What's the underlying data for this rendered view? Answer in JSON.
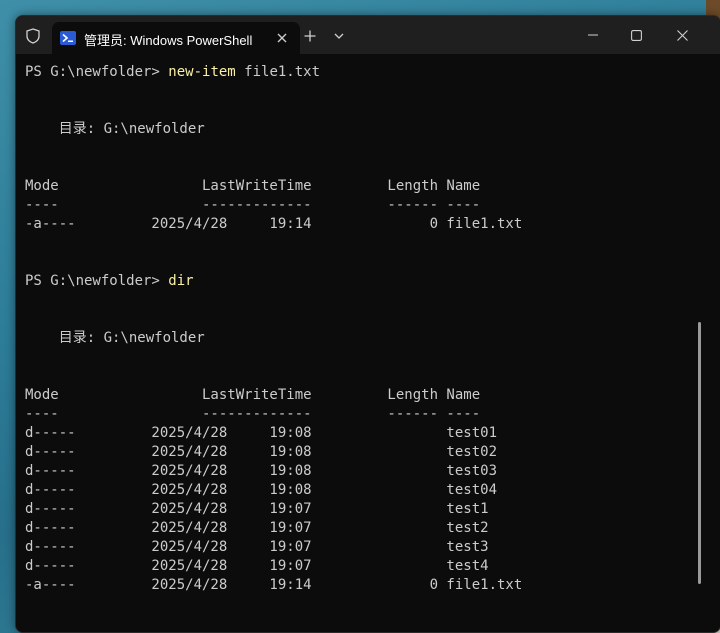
{
  "titlebar": {
    "tab_title": "管理员: Windows PowerShell",
    "new_tab_glyph": "+",
    "dropdown_glyph": "⌄"
  },
  "colors": {
    "terminal_bg": "#0c0c0c",
    "titlebar_bg": "#1f1f1f",
    "text": "#cccccc",
    "command": "#f9f1a5"
  },
  "terminal": {
    "block1": {
      "prompt": "PS G:\\newfolder> ",
      "command": "new-item",
      "args": " file1.txt",
      "directory": "    目录: G:\\newfolder",
      "header": "Mode                 LastWriteTime         Length Name",
      "underline": "----                 -------------         ------ ----",
      "rows": [
        "-a----         2025/4/28     19:14              0 file1.txt"
      ]
    },
    "block2": {
      "prompt": "PS G:\\newfolder> ",
      "command": "dir",
      "directory": "    目录: G:\\newfolder",
      "header": "Mode                 LastWriteTime         Length Name",
      "underline": "----                 -------------         ------ ----",
      "rows": [
        "d-----         2025/4/28     19:08                test01",
        "d-----         2025/4/28     19:08                test02",
        "d-----         2025/4/28     19:08                test03",
        "d-----         2025/4/28     19:08                test04",
        "d-----         2025/4/28     19:07                test1",
        "d-----         2025/4/28     19:07                test2",
        "d-----         2025/4/28     19:07                test3",
        "d-----         2025/4/28     19:07                test4",
        "-a----         2025/4/28     19:14              0 file1.txt"
      ]
    }
  }
}
